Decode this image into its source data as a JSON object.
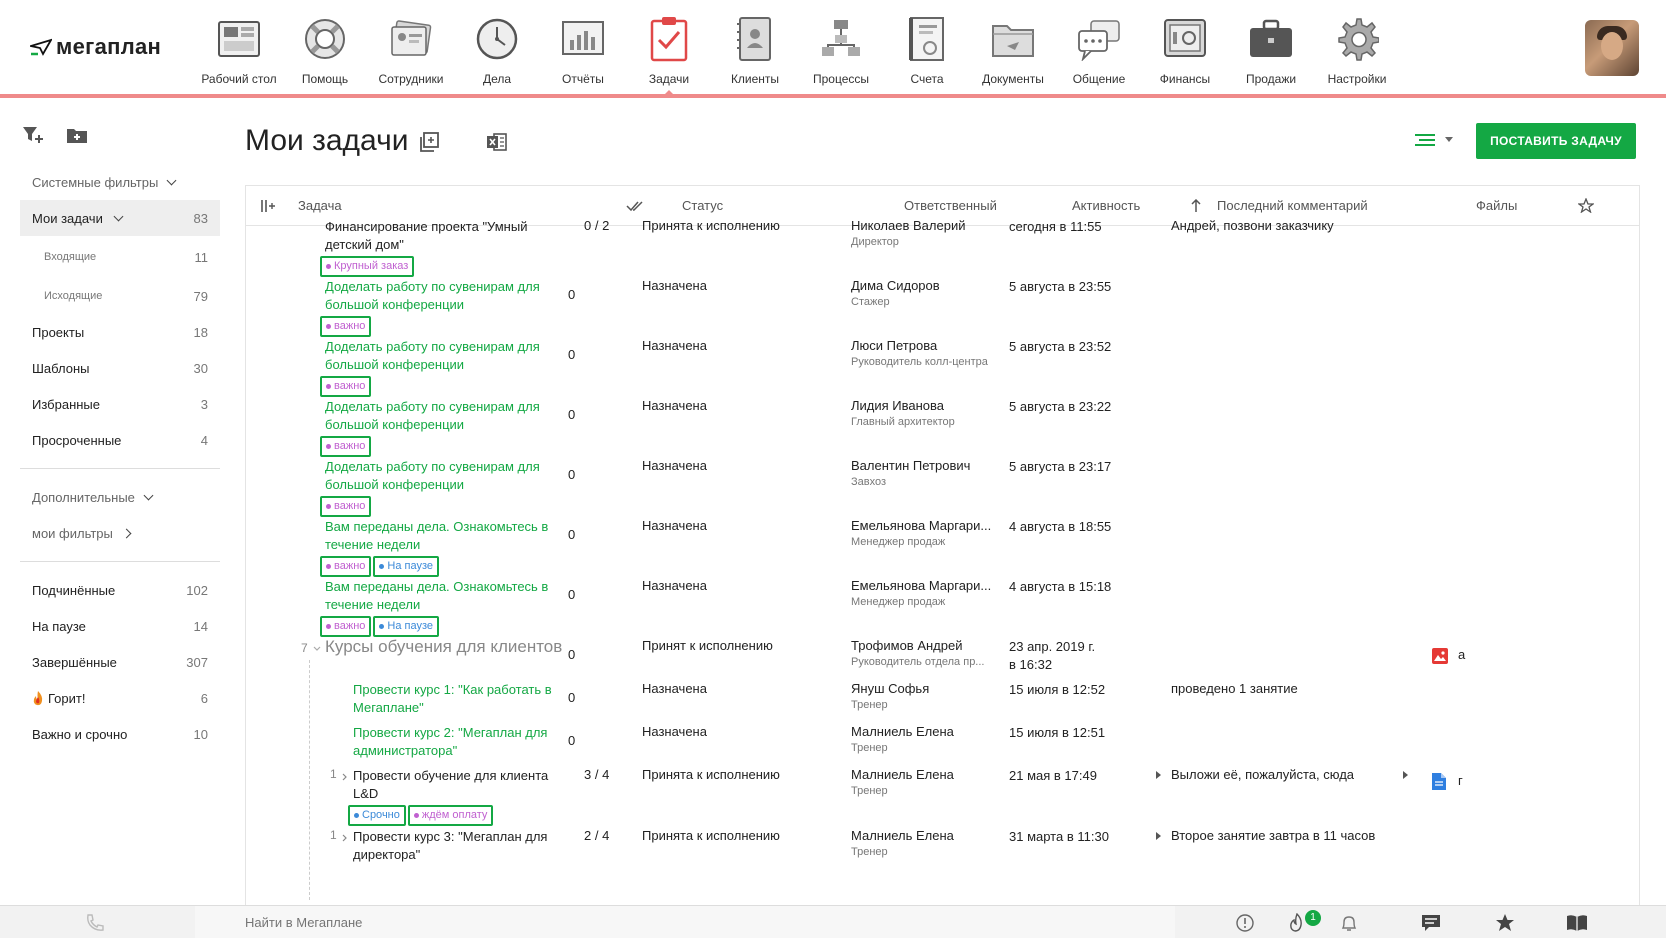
{
  "app": {
    "logo_text": "мегаплан"
  },
  "nav": [
    {
      "label": "Рабочий стол",
      "icon": "desktop-icon"
    },
    {
      "label": "Помощь",
      "icon": "lifebuoy-icon"
    },
    {
      "label": "Сотрудники",
      "icon": "employees-icon"
    },
    {
      "label": "Дела",
      "icon": "clock-icon"
    },
    {
      "label": "Отчёты",
      "icon": "chart-icon"
    },
    {
      "label": "Задачи",
      "icon": "tasks-clipboard-icon",
      "active": true
    },
    {
      "label": "Клиенты",
      "icon": "contacts-book-icon"
    },
    {
      "label": "Процессы",
      "icon": "process-flow-icon"
    },
    {
      "label": "Счета",
      "icon": "invoice-icon"
    },
    {
      "label": "Документы",
      "icon": "folder-icon"
    },
    {
      "label": "Общение",
      "icon": "chat-icon"
    },
    {
      "label": "Финансы",
      "icon": "safe-icon"
    },
    {
      "label": "Продажи",
      "icon": "briefcase-icon"
    },
    {
      "label": "Настройки",
      "icon": "gear-icon"
    }
  ],
  "sidebar": {
    "system_filters": "Системные фильтры",
    "my_tasks": {
      "label": "Мои задачи",
      "count": "83"
    },
    "items_top": [
      {
        "label": "Входящие",
        "count": "11",
        "sub": true
      },
      {
        "label": "Исходящие",
        "count": "79",
        "sub": true
      },
      {
        "label": "Проекты",
        "count": "18"
      },
      {
        "label": "Шаблоны",
        "count": "30"
      },
      {
        "label": "Избранные",
        "count": "3"
      },
      {
        "label": "Просроченные",
        "count": "4"
      }
    ],
    "additional": "Дополнительные",
    "my_filters": "мои фильтры",
    "items_bottom": [
      {
        "label": "Подчинённые",
        "count": "102"
      },
      {
        "label": "На паузе",
        "count": "14"
      },
      {
        "label": "Завершённые",
        "count": "307"
      },
      {
        "label": "Горит!",
        "count": "6",
        "icon": "fire-icon"
      },
      {
        "label": "Важно и срочно",
        "count": "10"
      }
    ]
  },
  "page": {
    "title": "Мои задачи",
    "create_button": "ПОСТАВИТЬ ЗАДАЧУ"
  },
  "table": {
    "headers": {
      "task": "Задача",
      "status": "Статус",
      "responsible": "Ответственный",
      "activity": "Активность",
      "last_comment": "Последний комментарий",
      "files": "Файлы"
    },
    "rows": [
      {
        "title": "Финансирование проекта \"Умный детский дом\"",
        "link": false,
        "progress": "0 / 2",
        "status": "Принята к исполнению",
        "person": "Николаев Валерий",
        "role": "Директор",
        "activity": "сегодня в 11:55",
        "activity2": "",
        "comment": "Андрей, позвони заказчику",
        "tags": [
          {
            "text": "Крупный заказ",
            "color": "#c060d0"
          }
        ]
      },
      {
        "title": "Доделать работу по сувенирам для большой конференции",
        "link": true,
        "progress": "0",
        "status": "Назначена",
        "person": "Дима Сидоров",
        "role": "Стажер",
        "activity": "5 августа в 23:55",
        "activity2": "",
        "comment": "",
        "tags": [
          {
            "text": "важно",
            "color": "#c060d0"
          }
        ]
      },
      {
        "title": "Доделать работу по сувенирам для большой конференции",
        "link": true,
        "progress": "0",
        "status": "Назначена",
        "person": "Люси Петрова",
        "role": "Руководитель колл-центра",
        "activity": "5 августа в 23:52",
        "activity2": "",
        "comment": "",
        "tags": [
          {
            "text": "важно",
            "color": "#c060d0"
          }
        ]
      },
      {
        "title": "Доделать работу по сувенирам для большой конференции",
        "link": true,
        "progress": "0",
        "status": "Назначена",
        "person": "Лидия Иванова",
        "role": "Главный архитектор",
        "activity": "5 августа в 23:22",
        "activity2": "",
        "comment": "",
        "tags": [
          {
            "text": "важно",
            "color": "#c060d0"
          }
        ]
      },
      {
        "title": "Доделать работу по сувенирам для большой конференции",
        "link": true,
        "progress": "0",
        "status": "Назначена",
        "person": "Валентин Петрович",
        "role": "Завхоз",
        "activity": "5 августа в 23:17",
        "activity2": "",
        "comment": "",
        "tags": [
          {
            "text": "важно",
            "color": "#c060d0"
          }
        ]
      },
      {
        "title": "Вам переданы дела. Ознакомьтесь в течение недели",
        "link": true,
        "progress": "0",
        "status": "Назначена",
        "person": "Емельянова Маргари...",
        "role": "Менеджер продаж",
        "activity": "4 августа в 18:55",
        "activity2": "",
        "comment": "",
        "tags": [
          {
            "text": "важно",
            "color": "#c060d0"
          },
          {
            "text": "На паузе",
            "color": "#3c8ad8"
          }
        ]
      },
      {
        "title": "Вам переданы дела. Ознакомьтесь в течение недели",
        "link": true,
        "progress": "0",
        "status": "Назначена",
        "person": "Емельянова Маргари...",
        "role": "Менеджер продаж",
        "activity": "4 августа в 15:18",
        "activity2": "",
        "comment": "",
        "tags": [
          {
            "text": "важно",
            "color": "#c060d0"
          },
          {
            "text": "На паузе",
            "color": "#3c8ad8"
          }
        ]
      },
      {
        "title": "Курсы обучения для клиентов",
        "link": false,
        "big": true,
        "count": "7",
        "progress": "0",
        "status": "Принят к исполнению",
        "person": "Трофимов Андрей",
        "role": "Руководитель отдела пр...",
        "activity": "23 апр. 2019 г.",
        "activity2": "в 16:32",
        "comment": "",
        "file_icon": "image-file-icon",
        "file_text": "а",
        "tags": []
      },
      {
        "title": "Провести курс 1: \"Как работать в Мегаплане\"",
        "link": true,
        "indent": true,
        "progress": "0",
        "status": "Назначена",
        "person": "Януш Софья",
        "role": "Тренер",
        "activity": "15 июля в 12:52",
        "activity2": "",
        "comment": "проведено 1 занятие",
        "tags": []
      },
      {
        "title": "Провести курс 2: \"Мегаплан для администратора\"",
        "link": true,
        "indent": true,
        "progress": "0",
        "status": "Назначена",
        "person": "Малниель Елена",
        "role": "Тренер",
        "activity": "15 июля в 12:51",
        "activity2": "",
        "comment": "",
        "tags": []
      },
      {
        "title": "Провести обучение для клиента L&D",
        "link": false,
        "indent": true,
        "count": "1",
        "progress": "3 / 4",
        "status": "Принята к исполнению",
        "person": "Малниель Елена",
        "role": "Тренер",
        "activity": "21 мая в 17:49",
        "activity2": "",
        "comment": "Выложи её, пожалуйста, сюда",
        "file_icon": "document-file-icon",
        "file_text": "г",
        "tags": [
          {
            "text": "Срочно",
            "color": "#3c8ad8"
          },
          {
            "text": "ждём оплату",
            "color": "#c060d0"
          }
        ]
      },
      {
        "title": "Провести курс 3: \"Мегаплан для директора\"",
        "link": false,
        "indent": true,
        "count": "1",
        "progress": "2 / 4",
        "status": "Принята к исполнению",
        "person": "Малниель Елена",
        "role": "Тренер",
        "activity": "31 марта в 11:30",
        "activity2": "",
        "comment": "Второе занятие завтра в 11 часов",
        "tags": []
      }
    ]
  },
  "bottom": {
    "search_placeholder": "Найти в Мегаплане",
    "notifications_badge": "1"
  }
}
